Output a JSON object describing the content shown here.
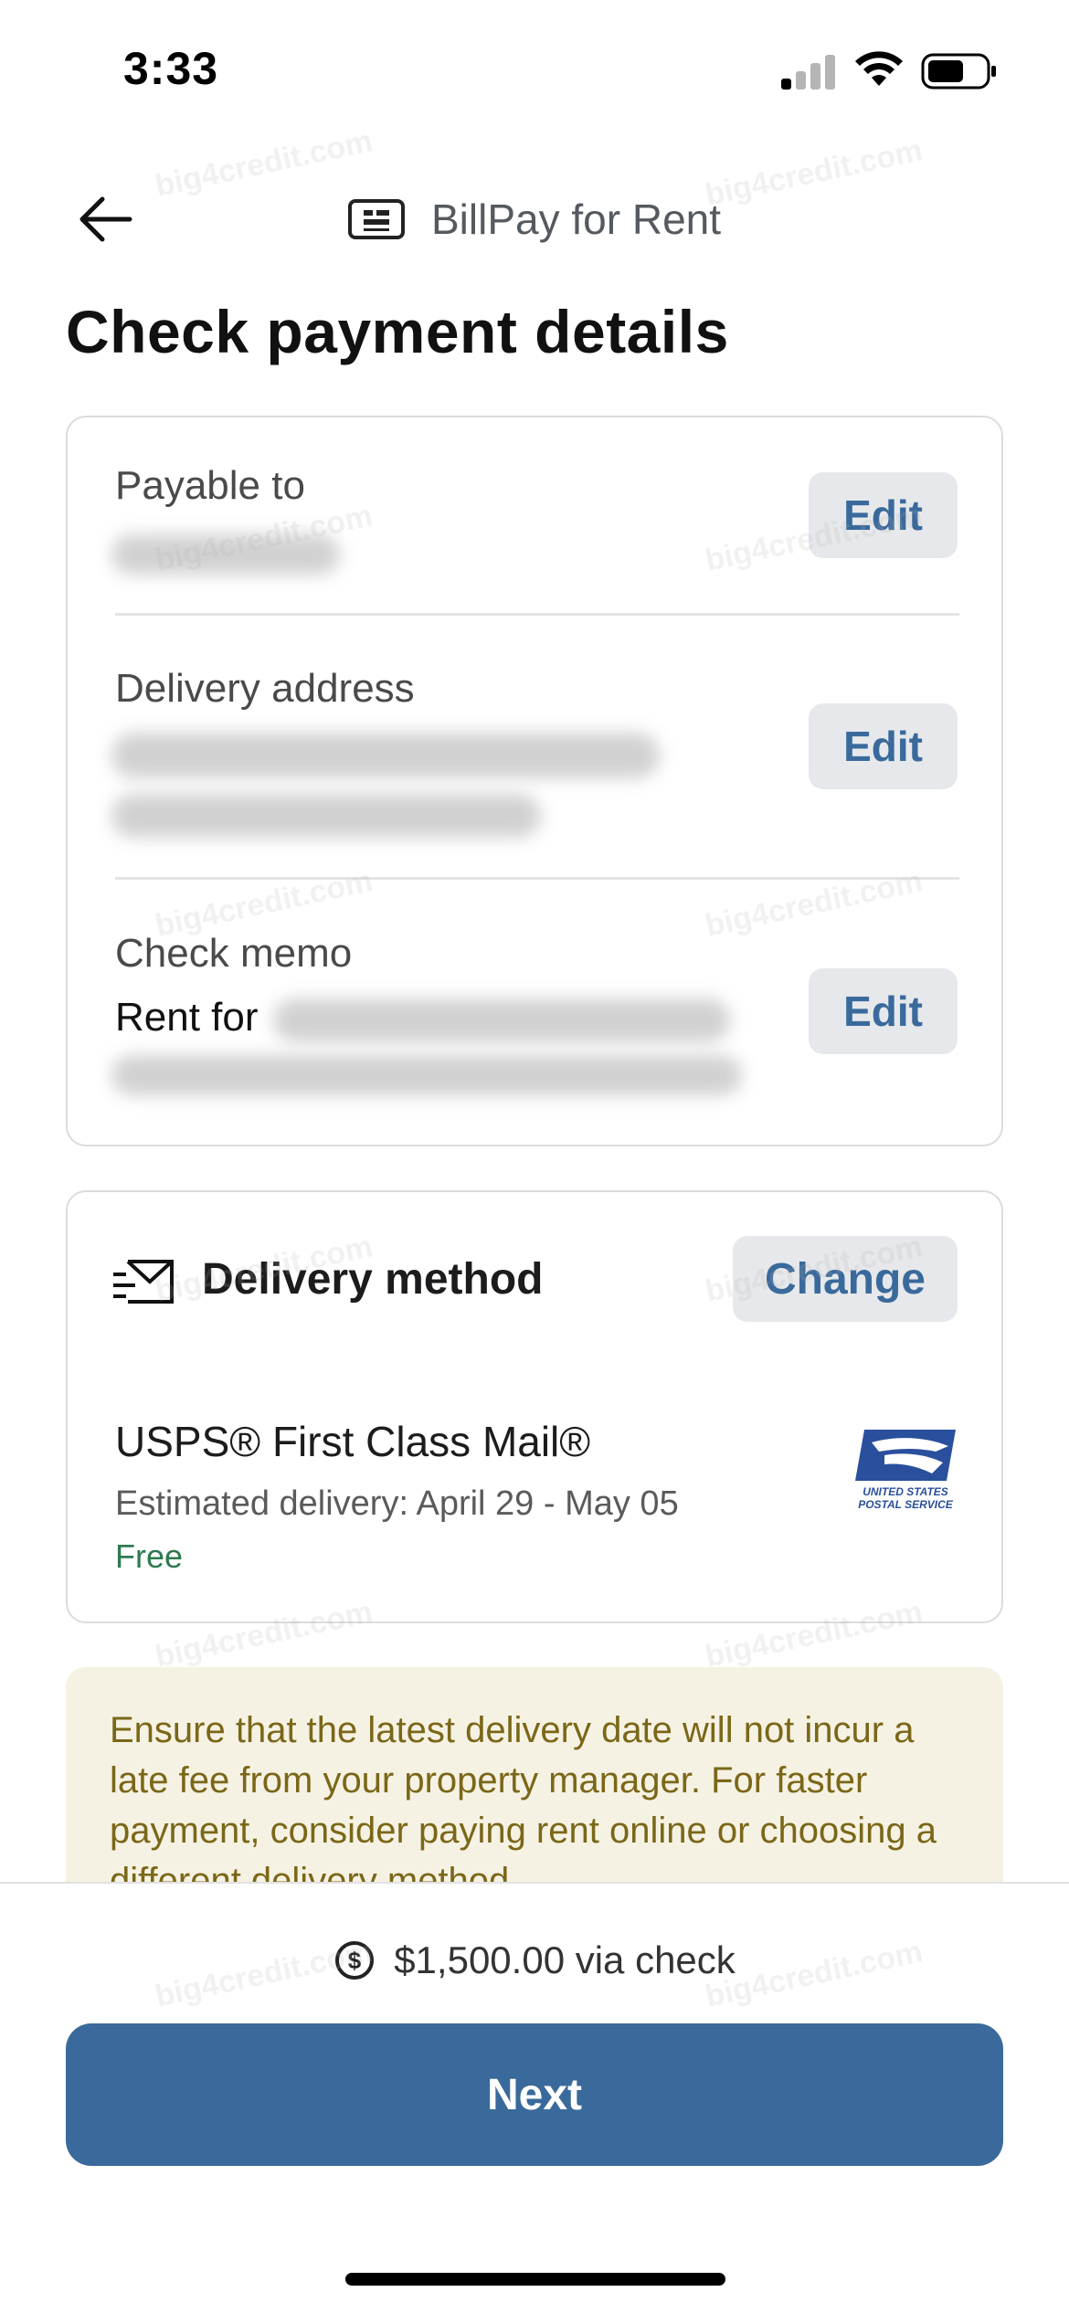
{
  "status_bar": {
    "time": "3:33"
  },
  "header": {
    "title": "BillPay for Rent"
  },
  "page_title": "Check payment details",
  "details": {
    "payable_to_label": "Payable to",
    "delivery_address_label": "Delivery address",
    "check_memo_label": "Check memo",
    "check_memo_prefix": "Rent for",
    "edit_label": "Edit"
  },
  "delivery": {
    "title": "Delivery method",
    "change_label": "Change",
    "service": "USPS® First Class Mail®",
    "estimate": "Estimated delivery: April 29 - May 05",
    "price": "Free",
    "logo_text_1": "UNITED STATES",
    "logo_text_2": "POSTAL SERVICE"
  },
  "notice": {
    "text": "Ensure that the latest delivery date will not incur a late fee from your property manager. For faster payment, consider paying rent online or choosing a different delivery method."
  },
  "footer": {
    "amount": "$1,500.00 via check",
    "next_label": "Next"
  },
  "watermark": "big4credit.com",
  "colors": {
    "accent": "#3a6a9c",
    "button_bg": "#e6e8eb",
    "free_green": "#2d7a4e",
    "notice_bg": "#f6f2e3",
    "notice_text": "#7a6718"
  }
}
